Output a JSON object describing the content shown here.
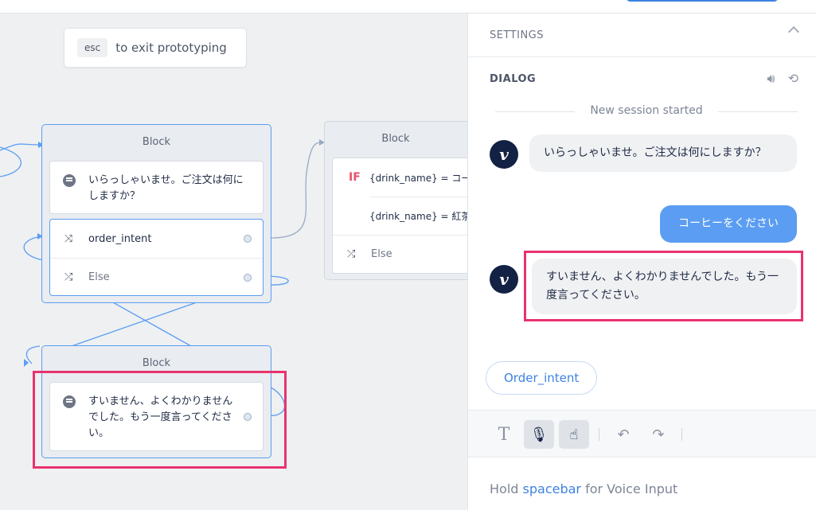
{
  "canvas": {
    "esc_key": "esc",
    "esc_text": "to exit prototyping",
    "block1": {
      "title": "Block",
      "speak": "いらっしゃいませ。ご注文は何にしますか？",
      "intent_label": "order_intent",
      "else_label": "Else"
    },
    "block2": {
      "title": "Block",
      "if_keyword": "IF",
      "cond1": "{drink_name} = コー",
      "cond2": "{drink_name} = 紅茶",
      "else_label": "Else"
    },
    "block3": {
      "title": "Block",
      "speak": "すいません、よくわかりませんでした。もう一度言ってください。"
    }
  },
  "panel": {
    "settings_label": "SETTINGS",
    "dialog_label": "DIALOG",
    "session_text": "New session started",
    "messages": [
      {
        "from": "bot",
        "avatar": "v",
        "text": "いらっしゃいませ。ご注文は何にしますか？"
      },
      {
        "from": "user",
        "text": "コーヒーをください"
      },
      {
        "from": "bot",
        "avatar": "v",
        "text": "すいません、よくわかりませんでした。もう一度言ってください。"
      }
    ],
    "suggestion_chip": "Order_intent",
    "toolbar": {
      "text_icon": "T",
      "mic_icon": "mic-icon",
      "touch_icon": "touch-icon",
      "undo_icon": "undo-icon",
      "redo_icon": "redo-icon"
    },
    "voice_prefix": "Hold",
    "voice_key": "spacebar",
    "voice_suffix": "for Voice Input"
  },
  "colors": {
    "accent": "#3d82e2",
    "user_bubble": "#5b9df2",
    "highlight": "#e8336e",
    "avatar": "#132144"
  }
}
